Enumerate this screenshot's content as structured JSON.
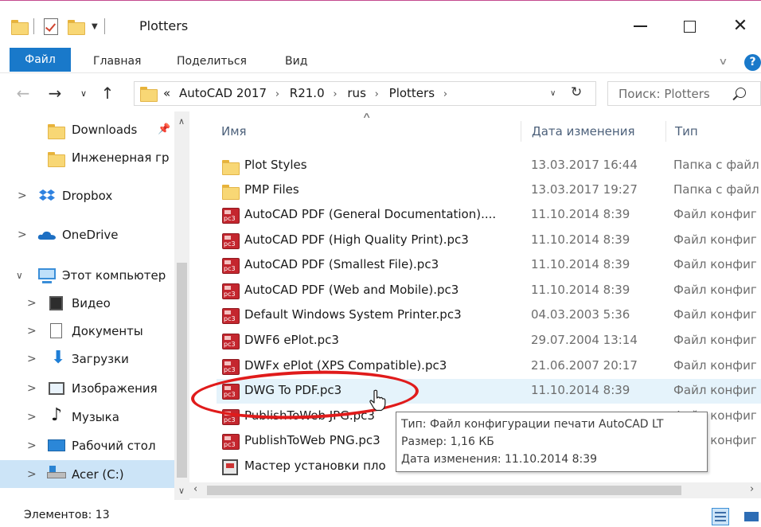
{
  "window": {
    "title": "Plotters",
    "close_glyph": "✕"
  },
  "ribbon": {
    "tabs": [
      "Файл",
      "Главная",
      "Поделиться",
      "Вид"
    ],
    "help_glyph": "?"
  },
  "address_bar": {
    "overflow": "«",
    "breadcrumbs": [
      "AutoCAD 2017",
      "R21.0",
      "rus",
      "Plotters"
    ],
    "separator": "›"
  },
  "search": {
    "placeholder": "Поиск: Plotters"
  },
  "sidebar": {
    "items": [
      {
        "label": "Downloads",
        "icon": "folder-icon",
        "pinned": true
      },
      {
        "label": "Инженерная гр",
        "icon": "folder-sync-icon"
      },
      {
        "label": "Dropbox",
        "icon": "dropbox-icon",
        "expander": ">"
      },
      {
        "label": "OneDrive",
        "icon": "onedrive-icon",
        "expander": ">"
      },
      {
        "label": "Этот компьютер",
        "icon": "computer-icon",
        "expander": "∨"
      },
      {
        "label": "Видео",
        "icon": "video-icon",
        "expander": ">"
      },
      {
        "label": "Документы",
        "icon": "documents-icon",
        "expander": ">"
      },
      {
        "label": "Загрузки",
        "icon": "downloads-icon",
        "expander": ">"
      },
      {
        "label": "Изображения",
        "icon": "images-icon",
        "expander": ">"
      },
      {
        "label": "Музыка",
        "icon": "music-icon",
        "expander": ">"
      },
      {
        "label": "Рабочий стол",
        "icon": "desktop-icon",
        "expander": ">"
      },
      {
        "label": "Acer (C:)",
        "icon": "drive-icon",
        "expander": ">",
        "selected": true
      }
    ]
  },
  "columns": {
    "name": "Имя",
    "date": "Дата изменения",
    "type": "Тип"
  },
  "files": [
    {
      "name": "Plot Styles",
      "date": "13.03.2017 16:44",
      "type": "Папка с файл",
      "icon": "folder-icon"
    },
    {
      "name": "PMP Files",
      "date": "13.03.2017 19:27",
      "type": "Папка с файл",
      "icon": "folder-icon"
    },
    {
      "name": "AutoCAD PDF (General Documentation)....",
      "date": "11.10.2014 8:39",
      "type": "Файл конфиг",
      "icon": "pc3-icon"
    },
    {
      "name": "AutoCAD PDF (High Quality Print).pc3",
      "date": "11.10.2014 8:39",
      "type": "Файл конфиг",
      "icon": "pc3-icon"
    },
    {
      "name": "AutoCAD PDF (Smallest File).pc3",
      "date": "11.10.2014 8:39",
      "type": "Файл конфиг",
      "icon": "pc3-icon"
    },
    {
      "name": "AutoCAD PDF (Web and Mobile).pc3",
      "date": "11.10.2014 8:39",
      "type": "Файл конфиг",
      "icon": "pc3-icon"
    },
    {
      "name": "Default Windows System Printer.pc3",
      "date": "04.03.2003 5:36",
      "type": "Файл конфиг",
      "icon": "pc3-icon"
    },
    {
      "name": "DWF6 ePlot.pc3",
      "date": "29.07.2004 13:14",
      "type": "Файл конфиг",
      "icon": "pc3-icon"
    },
    {
      "name": "DWFx ePlot (XPS Compatible).pc3",
      "date": "21.06.2007 20:17",
      "type": "Файл конфиг",
      "icon": "pc3-icon"
    },
    {
      "name": "DWG To PDF.pc3",
      "date": "11.10.2014 8:39",
      "type": "Файл конфиг",
      "icon": "pc3-icon",
      "hover": true
    },
    {
      "name": "PublishToWeb JPG.pc3",
      "date": "",
      "type": "Файл конфиг",
      "icon": "pc3-icon"
    },
    {
      "name": "PublishToWeb PNG.pc3",
      "date": "",
      "type": "Файл конфиг",
      "icon": "pc3-icon"
    },
    {
      "name": "Мастер установки пло",
      "date": "",
      "type": "к",
      "icon": "wizard-icon"
    }
  ],
  "tooltip": {
    "type_line": "Тип: Файл конфигурации печати AutoCAD LT",
    "size_line": "Размер: 1,16 КБ",
    "date_line": "Дата изменения: 11.10.2014 8:39"
  },
  "status": {
    "items_count": "Элементов: 13"
  },
  "colors": {
    "accent": "#1979ca",
    "selection": "#cce4f7",
    "hover": "#e5f3fb",
    "highlight_ring": "#e01b1b",
    "window_border": "#c44a8e"
  }
}
